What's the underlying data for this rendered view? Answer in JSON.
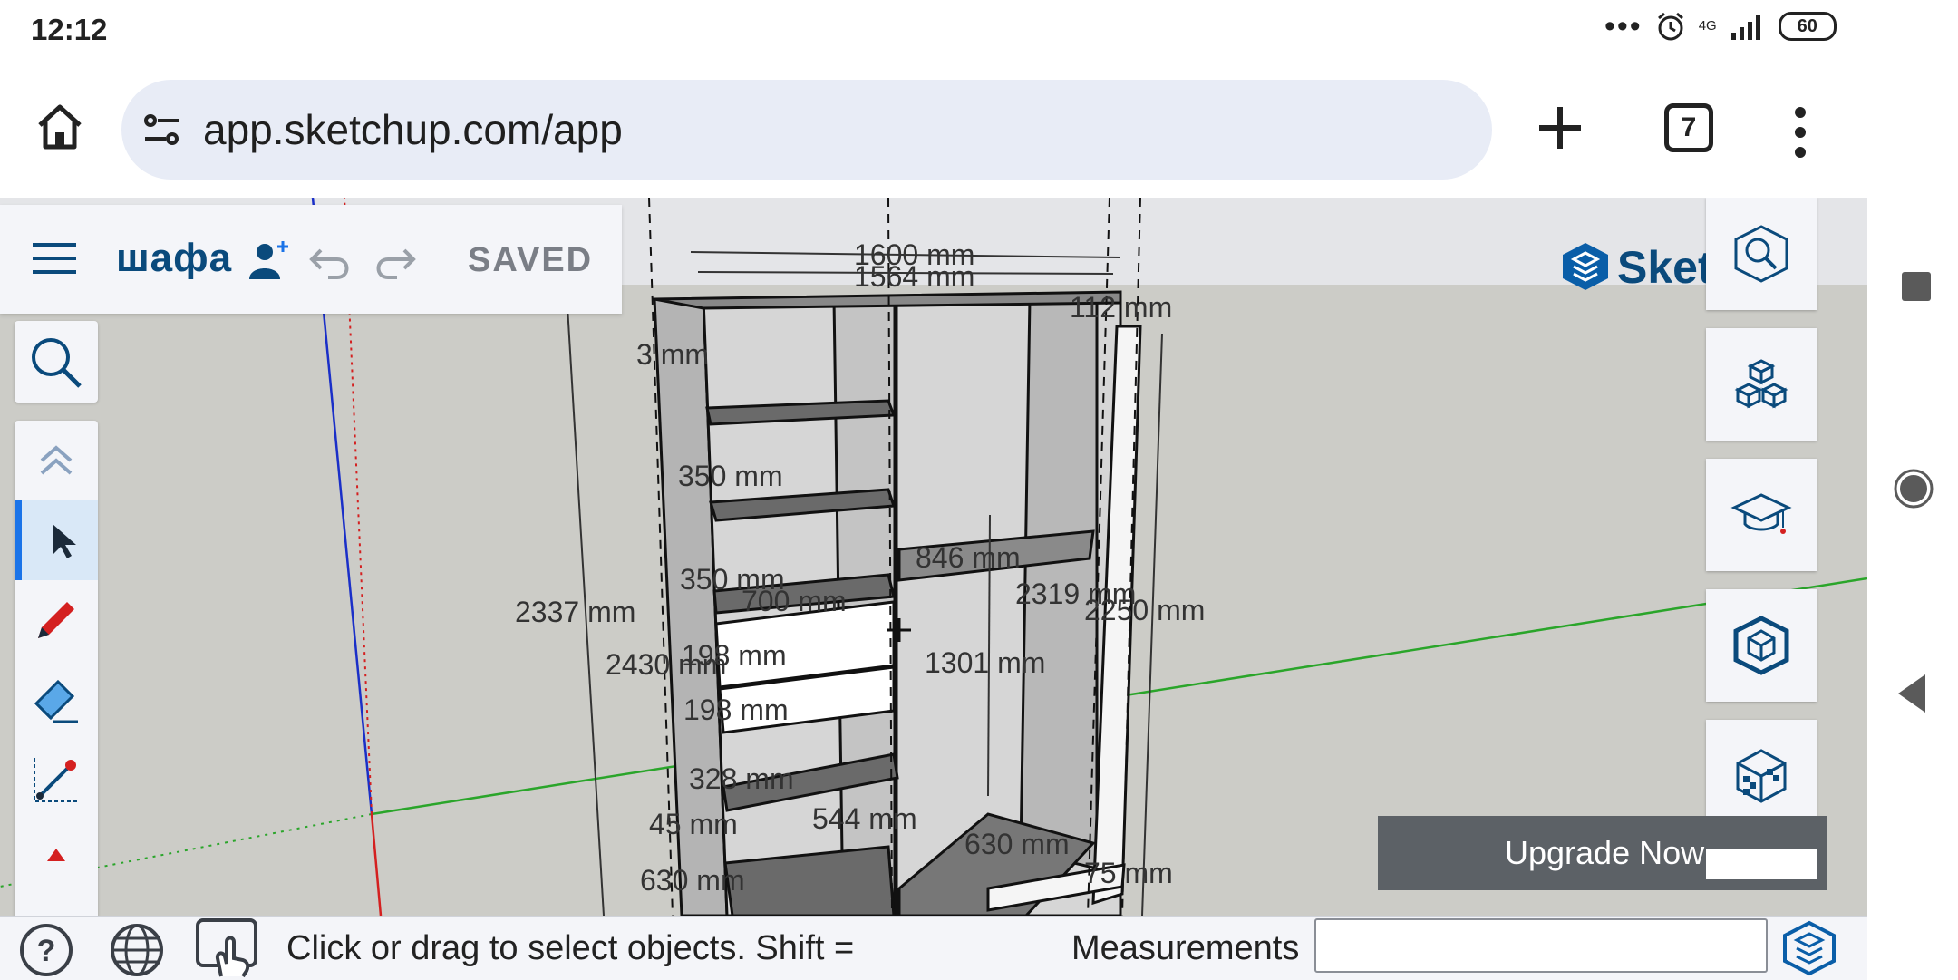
{
  "status_bar": {
    "time": "12:12",
    "dots": "•••",
    "network": "4G",
    "battery": "60"
  },
  "browser": {
    "url": "app.sketchup.com/app",
    "tab_count": "7"
  },
  "toolbar": {
    "model_name": "шафа",
    "saved_label": "SAVED"
  },
  "brand": {
    "name": "SketchUp"
  },
  "left_tools": [
    "search-icon",
    "collapse-chevron-icon",
    "select-arrow-icon",
    "pencil-icon",
    "eraser-icon",
    "line-icon",
    "more-tools-icon"
  ],
  "right_panel": [
    "scene-search-icon",
    "components-icon",
    "learn-icon",
    "model-info-icon",
    "materials-icon"
  ],
  "dimensions": {
    "d1600": "1600 mm",
    "d1564": "1564 mm",
    "d112": "112 mm",
    "d30": "3  mm",
    "d350a": "350 mm",
    "d350b": "350 mm",
    "d846": "846 mm",
    "d700": "700 mm",
    "d2319": "2319 mm",
    "d2250": "2250 mm",
    "d2337": "2337 mm",
    "d198a": "198 mm",
    "d2430": "2430 mm",
    "d1301": "1301 mm",
    "d198b": "198 mm",
    "d328": "328 mm",
    "d45": "45  mm",
    "d544": "544 mm",
    "d630a": "630 mm",
    "d630b": "630 mm",
    "d75": "75 mm"
  },
  "upgrade": {
    "label": "Upgrade Now"
  },
  "bottom": {
    "hint": "Click or drag to select objects. Shift =",
    "measurements_label": "Measurements",
    "measurements_value": ""
  },
  "colors": {
    "brand_blue": "#0a4a7c",
    "active_tool": "#1a73e8",
    "viewport_bg": "#ccccc7",
    "axis_green": "#2aa52a",
    "axis_blue": "#1a2fc8",
    "axis_red": "#d42020"
  }
}
